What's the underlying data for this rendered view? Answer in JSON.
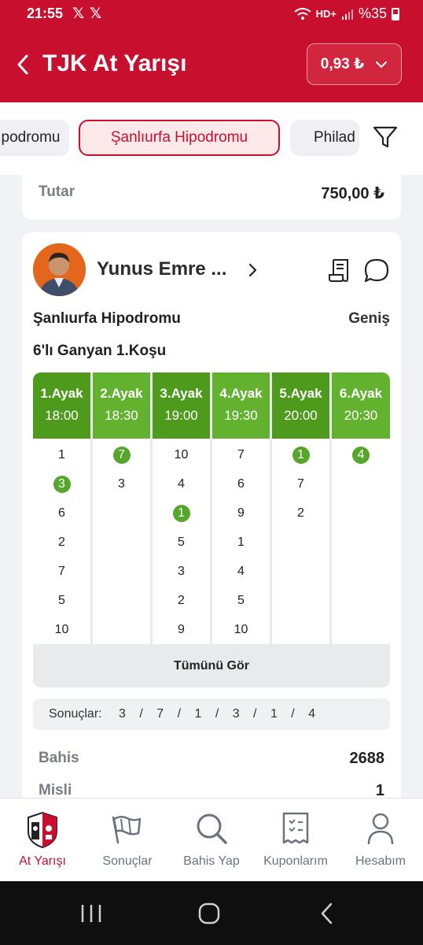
{
  "status": {
    "time": "21:55",
    "notif1": "𝕏",
    "notif2": "𝕏",
    "network": "HD+",
    "battery": "%35"
  },
  "header": {
    "title": "TJK At Yarışı",
    "balance": "0,93 ₺"
  },
  "tabs": [
    {
      "label": "podromu"
    },
    {
      "label": "Şanlıurfa Hipodromu"
    },
    {
      "label": "Philad"
    }
  ],
  "card1": {
    "label": "Tutar",
    "value": "750,00 ₺"
  },
  "coupon": {
    "user": "Yunus Emre ...",
    "hippodrome": "Şanlıurfa Hipodromu",
    "type": "Geniş",
    "race": "6'lı Ganyan 1.Koşu",
    "legs": [
      {
        "leg": "1.Ayak",
        "time": "18:00",
        "picks": [
          "1",
          "3",
          "6",
          "2",
          "7",
          "5",
          "10"
        ],
        "winner": "3"
      },
      {
        "leg": "2.Ayak",
        "time": "18:30",
        "picks": [
          "7",
          "3"
        ],
        "winner": "7"
      },
      {
        "leg": "3.Ayak",
        "time": "19:00",
        "picks": [
          "10",
          "4",
          "1",
          "5",
          "3",
          "2",
          "9"
        ],
        "winner": "1"
      },
      {
        "leg": "4.Ayak",
        "time": "19:30",
        "picks": [
          "7",
          "6",
          "9",
          "1",
          "4",
          "5",
          "10"
        ],
        "winner": ""
      },
      {
        "leg": "5.Ayak",
        "time": "20:00",
        "picks": [
          "1",
          "7",
          "2"
        ],
        "winner": "1"
      },
      {
        "leg": "6.Ayak",
        "time": "20:30",
        "picks": [
          "4"
        ],
        "winner": "4"
      }
    ],
    "see_all": "Tümünü Gör",
    "results_label": "Sonuçlar:",
    "results": "3 / 7 / 1 / 3 / 1 / 4",
    "bets_label": "Bahis",
    "bets_value": "2688",
    "multiplier_label": "Misli",
    "multiplier_value": "1"
  },
  "bottom_nav": [
    {
      "label": "At Yarışı",
      "icon": "tjk-logo-icon",
      "active": true
    },
    {
      "label": "Sonuçlar",
      "icon": "flag-icon"
    },
    {
      "label": "Bahis Yap",
      "icon": "search-icon"
    },
    {
      "label": "Kuponlarım",
      "icon": "receipt-icon"
    },
    {
      "label": "Hesabım",
      "icon": "user-icon"
    }
  ],
  "colors": {
    "brand": "#c8102e",
    "leg_dark": "#4e9a1c",
    "leg_light": "#62b22f",
    "winner": "#55a62a"
  }
}
